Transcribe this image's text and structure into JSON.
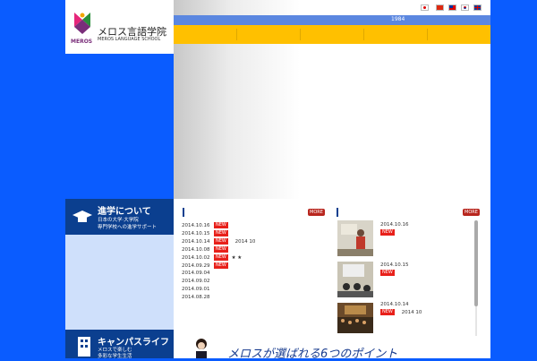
{
  "logo": {
    "name_ja": "メロス言語学院",
    "name_en": "MEROS LANGUAGE SCHOOL",
    "mark_text": "MEROS"
  },
  "header": {
    "bar_text": "1984",
    "flags": [
      "japan-flag-icon",
      "china-flag-icon",
      "taiwan-flag-icon",
      "korea-flag-icon",
      "uk-flag-icon"
    ]
  },
  "sidebar": {
    "items": [
      {
        "title": "進学について",
        "lines": [
          "日本の大学·大学院",
          "専門学校への進学サポート"
        ]
      },
      {
        "title": "キャンパスライフ",
        "lines": [
          "メロスで楽しむ",
          "多彩な学生生活"
        ]
      }
    ]
  },
  "news": {
    "more_label": "MORE",
    "new_label": "NEW",
    "items": [
      {
        "date": "2014.10.16",
        "new": true,
        "text": ""
      },
      {
        "date": "2014.10.15",
        "new": true,
        "text": ""
      },
      {
        "date": "2014.10.14",
        "new": true,
        "text": "2014 10"
      },
      {
        "date": "2014.10.08",
        "new": true,
        "text": ""
      },
      {
        "date": "2014.10.02",
        "new": true,
        "text": "★ ★"
      },
      {
        "date": "2014.09.29",
        "new": true,
        "text": ""
      },
      {
        "date": "2014.09.04",
        "new": false,
        "text": ""
      },
      {
        "date": "2014.09.02",
        "new": false,
        "text": ""
      },
      {
        "date": "2014.09.01",
        "new": false,
        "text": ""
      },
      {
        "date": "2014.08.28",
        "new": false,
        "text": ""
      }
    ]
  },
  "blog": {
    "more_label": "MORE",
    "new_label": "NEW",
    "items": [
      {
        "date": "2014.10.16",
        "text": ""
      },
      {
        "date": "2014.10.15",
        "text": ""
      },
      {
        "date": "2014.10.14",
        "text": "2014 10"
      }
    ]
  },
  "banner": {
    "text": "メロスが選ばれる6つのポイント"
  },
  "colors": {
    "background": "#0a5cff",
    "nav_yellow": "#ffc000",
    "navy": "#0b3f8f",
    "new_red": "#e8201a"
  }
}
